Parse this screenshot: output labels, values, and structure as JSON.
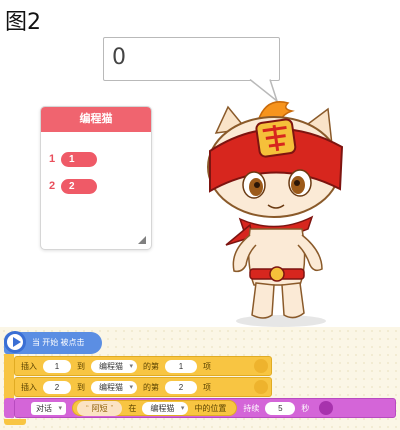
{
  "figure_label": "图2",
  "stage": {
    "speech_bubble": {
      "text": "0"
    },
    "list_monitor": {
      "title": "编程猫",
      "items": [
        {
          "index": "1",
          "value": "1"
        },
        {
          "index": "2",
          "value": "2"
        }
      ]
    },
    "sprite": {
      "name": "cat-sprite-icon"
    }
  },
  "code": {
    "hat_block": {
      "label": "当 开始 被点击"
    },
    "insert_blocks": [
      {
        "verb": "插入",
        "value": "1",
        "to": "到",
        "list": "编程猫",
        "of": "的第",
        "position": "1",
        "unit": "项"
      },
      {
        "verb": "插入",
        "value": "2",
        "to": "到",
        "list": "编程猫",
        "of": "的第",
        "position": "2",
        "unit": "项"
      }
    ],
    "say_block": {
      "action": "对话",
      "text": "阿短",
      "in": "在",
      "list": "编程猫",
      "position_of": "中的位置",
      "duration_label": "持续",
      "seconds": "5",
      "unit": "秒"
    }
  },
  "colors": {
    "list_header": "#f0646f",
    "event_block": "#5b8ee3",
    "list_block": "#f8c542",
    "looks_block": "#d465d8"
  }
}
